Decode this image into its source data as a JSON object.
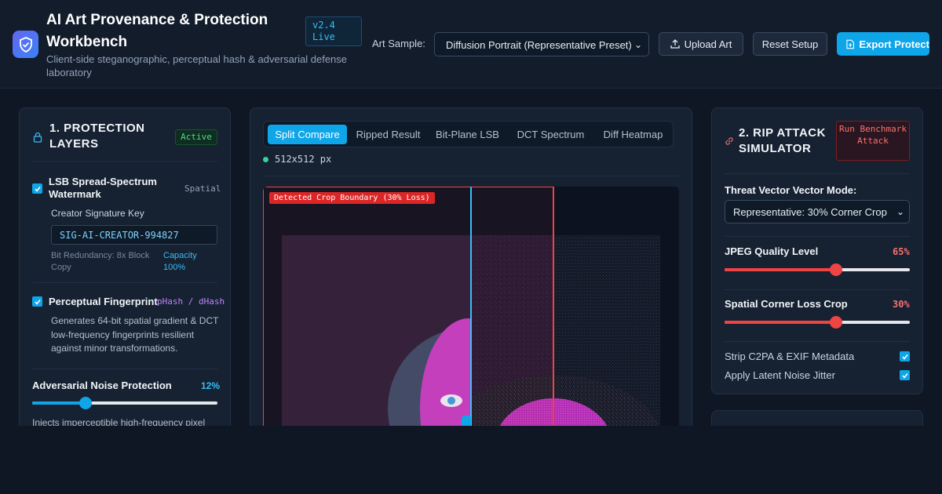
{
  "header": {
    "title": "AI Art Provenance & Protection Workbench",
    "version": "v2.4 Live",
    "subtitle": "Client-side steganographic, perceptual hash & adversarial defense laboratory",
    "sample_label": "Art Sample:",
    "sample_value": "Diffusion Portrait (Representative Preset)",
    "upload_label": "Upload Art",
    "reset_label": "Reset Setup",
    "export_label": "Export Protect"
  },
  "protection": {
    "title": "1. PROTECTION LAYERS",
    "status": "Active",
    "lsb": {
      "checked": true,
      "title": "LSB Spread-Spectrum Watermark",
      "tag": "Spatial",
      "key_label": "Creator Signature Key",
      "key_value": "SIG-AI-CREATOR-994827",
      "redundancy": "Bit Redundancy: 8x Block Copy",
      "capacity": "Capacity 100%"
    },
    "fingerprint": {
      "checked": true,
      "title": "Perceptual Fingerprint",
      "tag": "pHash / dHash",
      "description": "Generates 64-bit spatial gradient & DCT low-frequency fingerprints resilient against minor transformations."
    },
    "noise": {
      "title": "Adversarial Noise Protection",
      "value": "12%",
      "level": 0.29,
      "description": "Injects imperceptible high-frequency pixel"
    }
  },
  "viewer": {
    "tabs": [
      "Split Compare",
      "Ripped Result",
      "Bit-Plane LSB",
      "DCT Spectrum",
      "Diff Heatmap"
    ],
    "active_tab": 0,
    "resolution": "512x512 px",
    "crop_label": "Detected Crop Boundary (30% Loss)"
  },
  "attack": {
    "title": "2. RIP ATTACK SIMULATOR",
    "run_label": "Run Benchmark Attack",
    "vector_label": "Threat Vector Vector Mode:",
    "vector_value": "Representative: 30% Corner Crop",
    "jpeg_label": "JPEG Quality Level",
    "jpeg_value": "65%",
    "jpeg_level": 0.6,
    "crop_label": "Spatial Corner Loss Crop",
    "crop_value": "30%",
    "crop_level": 0.6,
    "strip_label": "Strip C2PA & EXIF Metadata",
    "strip_checked": true,
    "jitter_label": "Apply Latent Noise Jitter",
    "jitter_checked": true
  },
  "colors": {
    "accent": "#0ea5e9",
    "danger": "#ef4444",
    "success": "#4ade80"
  }
}
